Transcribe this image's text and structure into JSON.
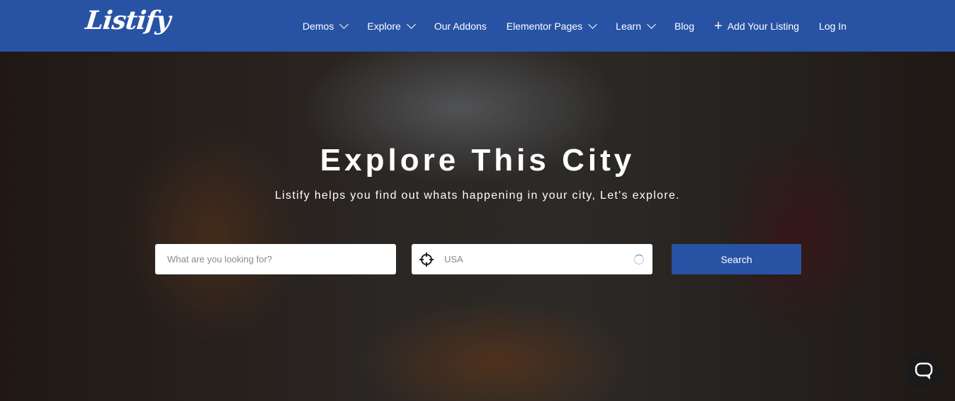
{
  "nav": {
    "logo": "Listify",
    "items": [
      {
        "label": "Demos",
        "dropdown": true
      },
      {
        "label": "Explore",
        "dropdown": true
      },
      {
        "label": "Our Addons",
        "dropdown": false
      },
      {
        "label": "Elementor Pages",
        "dropdown": true
      },
      {
        "label": "Learn",
        "dropdown": true
      },
      {
        "label": "Blog",
        "dropdown": false
      }
    ],
    "add_listing": "Add Your Listing",
    "login": "Log In"
  },
  "hero": {
    "title": "Explore This City",
    "subtitle": "Listify helps you find out whats happening in your city, Let's explore.",
    "search": {
      "keyword_placeholder": "What are you looking for?",
      "location_value": "USA",
      "button": "Search"
    }
  },
  "colors": {
    "brand": "#2853a4"
  }
}
